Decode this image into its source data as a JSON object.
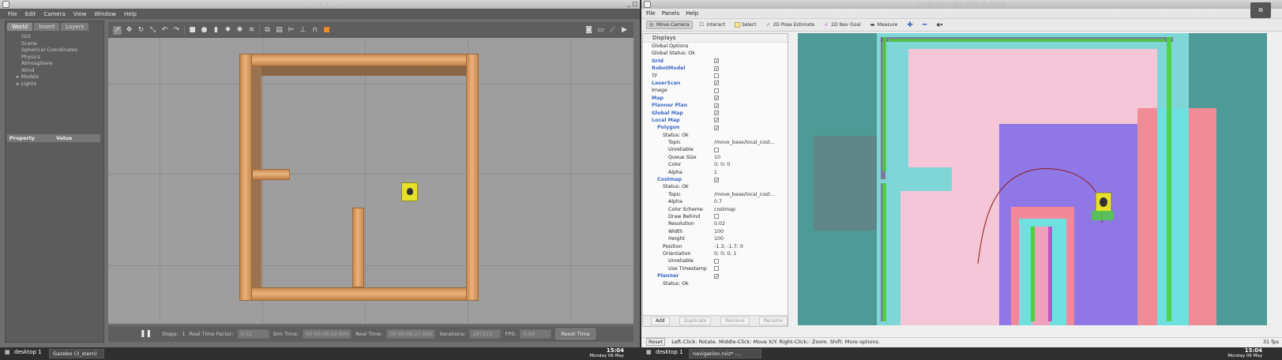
{
  "gazebo": {
    "title": "Gazebo (3_stern)",
    "menu": [
      "File",
      "Edit",
      "Camera",
      "View",
      "Window",
      "Help"
    ],
    "left_tabs": [
      "World",
      "Insert",
      "Layers"
    ],
    "tree": [
      "GUI",
      "Scene",
      "Spherical Coordinates",
      "Physics",
      "Atmosphere",
      "Wind",
      "Models",
      "Lights"
    ],
    "property_header": "Property",
    "value_header": "Value",
    "bottom": {
      "steps_label": "Steps:",
      "steps_value": "1",
      "rtf_label": "Real Time Factor:",
      "rtf_value": "0.52",
      "sim_label": "Sim Time:",
      "sim_value": "00 00:08:42.400",
      "real_label": "Real Time:",
      "real_value": "00 00:06:27.685",
      "iter_label": "Iterations:",
      "iter_value": "287313",
      "fps_label": "FPS:",
      "fps_value": "0.89",
      "reset_label": "Reset Time"
    }
  },
  "rviz": {
    "title": "navigation.rviz* - RViz (3_stern)",
    "menu": [
      "File",
      "Panels",
      "Help"
    ],
    "toolbar": [
      "Move Camera",
      "Interact",
      "Select",
      "2D Pose Estimate",
      "2D Nav Goal",
      "Measure"
    ],
    "displays_title": "Displays",
    "rows": [
      {
        "label": "Global Options",
        "indent": 1,
        "blue": false,
        "check": null,
        "value": ""
      },
      {
        "label": "Global Status: Ok",
        "indent": 1,
        "blue": false,
        "check": null,
        "value": ""
      },
      {
        "label": "Grid",
        "indent": 1,
        "blue": true,
        "check": true,
        "value": ""
      },
      {
        "label": "RobotModel",
        "indent": 1,
        "blue": true,
        "check": true,
        "value": ""
      },
      {
        "label": "TF",
        "indent": 1,
        "blue": false,
        "check": false,
        "value": ""
      },
      {
        "label": "LaserScan",
        "indent": 1,
        "blue": true,
        "check": true,
        "value": ""
      },
      {
        "label": "Image",
        "indent": 1,
        "blue": false,
        "check": false,
        "value": ""
      },
      {
        "label": "Map",
        "indent": 1,
        "blue": true,
        "check": true,
        "value": ""
      },
      {
        "label": "Planner Plan",
        "indent": 1,
        "blue": true,
        "check": true,
        "value": ""
      },
      {
        "label": "Global Map",
        "indent": 1,
        "blue": true,
        "check": true,
        "value": ""
      },
      {
        "label": "Local Map",
        "indent": 1,
        "blue": true,
        "check": true,
        "value": ""
      },
      {
        "label": "Polygon",
        "indent": 2,
        "blue": true,
        "check": true,
        "value": ""
      },
      {
        "label": "Status: Ok",
        "indent": 3,
        "blue": false,
        "check": null,
        "value": ""
      },
      {
        "label": "Topic",
        "indent": 4,
        "blue": false,
        "check": null,
        "value": "/move_base/local_cost..."
      },
      {
        "label": "Unreliable",
        "indent": 4,
        "blue": false,
        "check": false,
        "value": ""
      },
      {
        "label": "Queue Size",
        "indent": 4,
        "blue": false,
        "check": null,
        "value": "10"
      },
      {
        "label": "Color",
        "indent": 4,
        "blue": false,
        "check": null,
        "value": "0; 0; 0"
      },
      {
        "label": "Alpha",
        "indent": 4,
        "blue": false,
        "check": null,
        "value": "1"
      },
      {
        "label": "Costmap",
        "indent": 2,
        "blue": true,
        "check": true,
        "value": ""
      },
      {
        "label": "Status: Ok",
        "indent": 3,
        "blue": false,
        "check": null,
        "value": ""
      },
      {
        "label": "Topic",
        "indent": 4,
        "blue": false,
        "check": null,
        "value": "/move_base/local_cost..."
      },
      {
        "label": "Alpha",
        "indent": 4,
        "blue": false,
        "check": null,
        "value": "0.7"
      },
      {
        "label": "Color Scheme",
        "indent": 4,
        "blue": false,
        "check": null,
        "value": "costmap"
      },
      {
        "label": "Draw Behind",
        "indent": 4,
        "blue": false,
        "check": false,
        "value": ""
      },
      {
        "label": "Resolution",
        "indent": 4,
        "blue": false,
        "check": null,
        "value": "0.02"
      },
      {
        "label": "Width",
        "indent": 4,
        "blue": false,
        "check": null,
        "value": "100"
      },
      {
        "label": "Height",
        "indent": 4,
        "blue": false,
        "check": null,
        "value": "100"
      },
      {
        "label": "Position",
        "indent": 3,
        "blue": false,
        "check": null,
        "value": "-1.3; -1.7; 0"
      },
      {
        "label": "Orientation",
        "indent": 3,
        "blue": false,
        "check": null,
        "value": "0; 0; 0; 1"
      },
      {
        "label": "Unreliable",
        "indent": 4,
        "blue": false,
        "check": false,
        "value": ""
      },
      {
        "label": "Use Timestamp",
        "indent": 4,
        "blue": false,
        "check": false,
        "value": ""
      },
      {
        "label": "Planner",
        "indent": 2,
        "blue": true,
        "check": true,
        "value": ""
      },
      {
        "label": "Status: Ok",
        "indent": 3,
        "blue": false,
        "check": null,
        "value": ""
      }
    ],
    "buttons": [
      "Add",
      "Duplicate",
      "Remove",
      "Rename"
    ],
    "status_prefix": "Reset",
    "status_text": "Left-Click: Rotate. Middle-Click: Move X/Y. Right-Click:: Zoom. Shift: More options.",
    "fps": "31 fps"
  },
  "taskbar": {
    "left_desktop": "desktop 1",
    "left_task": "Gazebo (3_stern)",
    "left_time": "15:04",
    "left_date": "Monday 06 May",
    "right_desktop": "desktop 1",
    "right_task": "navigation.rviz* -...",
    "right_time": "15:04",
    "right_date": "Monday 06 May"
  }
}
